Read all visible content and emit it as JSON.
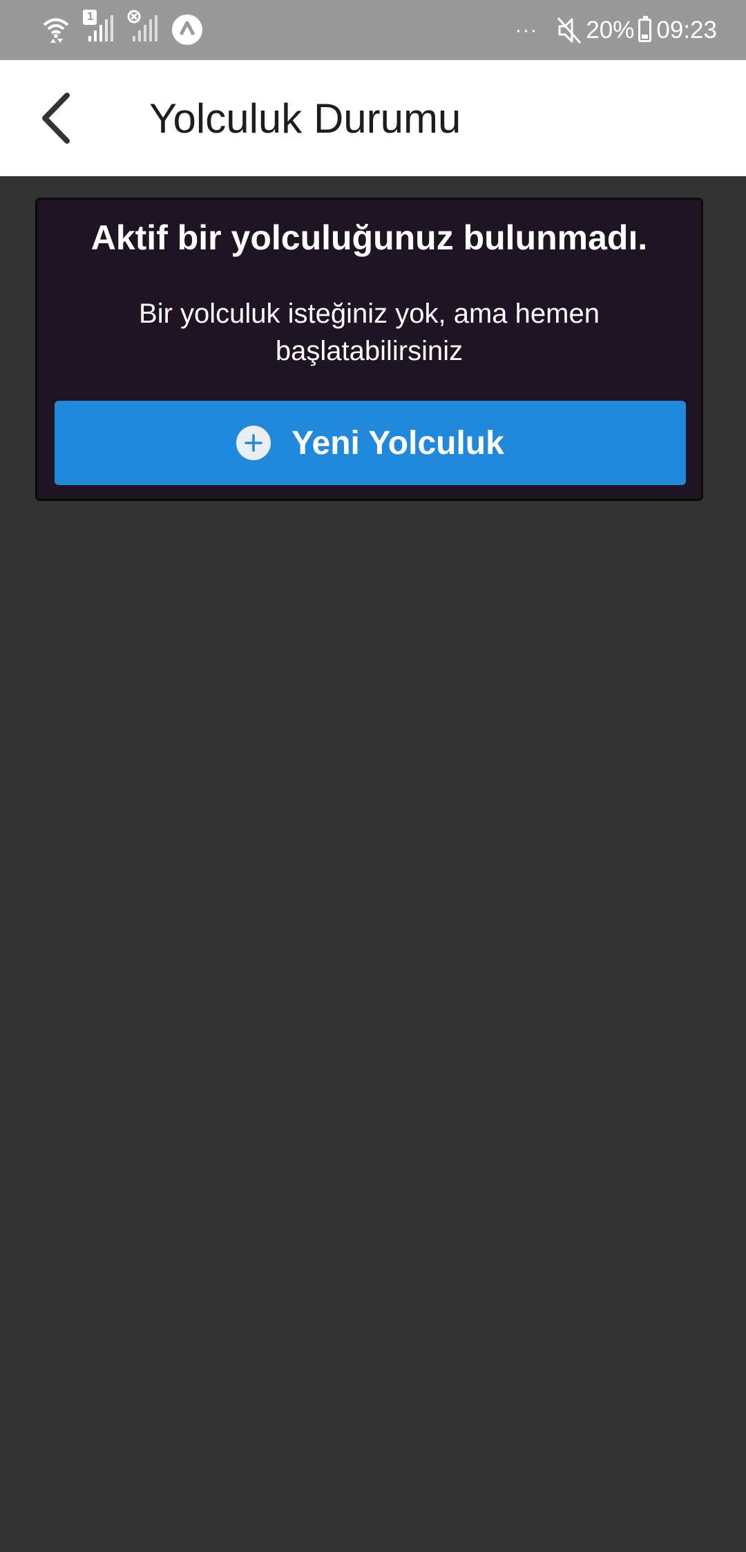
{
  "status_bar": {
    "sim_badge": "1",
    "battery_level": "20%",
    "time": "09:23",
    "overflow_label": "···",
    "icons": [
      "wifi-icon",
      "signal-sim1-icon",
      "signal-sim2-no-service-icon",
      "app-notification-icon",
      "mute-icon",
      "battery-icon"
    ],
    "battery_fill_fraction": 0.2
  },
  "header": {
    "title": "Yolculuk Durumu",
    "back_icon": "chevron-left-icon"
  },
  "card": {
    "title": "Aktif bir yolculuğunuz bulunmadı.",
    "message": "Bir yolculuk isteğiniz yok, ama hemen başlatabilirsiniz",
    "button_label": "Yeni Yolculuk",
    "button_icon": "plus-circle-icon"
  },
  "colors": {
    "status_bar_bg": "#999999",
    "header_bg": "#ffffff",
    "page_bg": "#333333",
    "card_bg": "#1e1424",
    "accent_button": "#2089dc"
  }
}
